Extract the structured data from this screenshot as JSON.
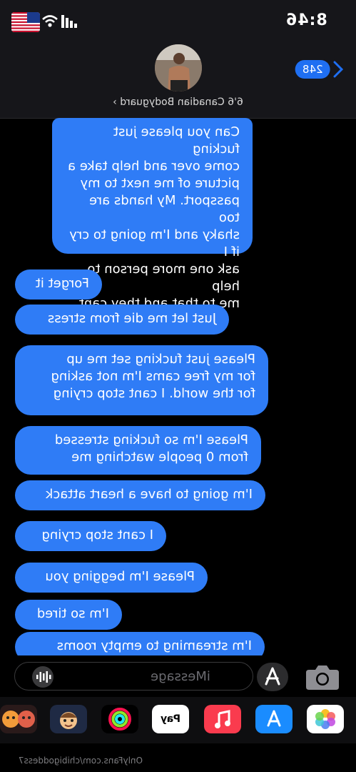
{
  "status": {
    "time": "8:46"
  },
  "header": {
    "back_count": "248",
    "contact_name": "6'6 Canadian Bodyguard"
  },
  "messages": [
    {
      "text": "Can you please just fucking\ncome over and help take a\npicture of me next to my\npassport. My hands are too\nshaky and I'm going to cry if I\nask one more person to help\nme to that and they cant."
    },
    {
      "text": "Forget it"
    },
    {
      "text": "Just let me die from stress"
    },
    {
      "text": "Please just fucking set me up\nfor my free cams I'm not asking\nfor the world. I cant stop crying"
    },
    {
      "text": "Please I'm so fucking stressed\nfrom 0 people watching me"
    },
    {
      "text": "I'm going to have a heart attack"
    },
    {
      "text": "I cant stop crying"
    },
    {
      "text": "Please I'm begging you"
    },
    {
      "text": "I'm so tired"
    },
    {
      "text": "I'm streaming to empty rooms"
    }
  ],
  "composer": {
    "placeholder": "iMessage"
  },
  "apps": [
    {
      "name": "photos",
      "color": "#ffffff"
    },
    {
      "name": "app-store",
      "color": "#1a8cff"
    },
    {
      "name": "music",
      "color": "#fa3b4e"
    },
    {
      "name": "apple-pay",
      "label": "Pay",
      "color": "#ffffff"
    },
    {
      "name": "activity",
      "color": "#000000"
    },
    {
      "name": "memoji",
      "color": "#f2b45c"
    },
    {
      "name": "stickers",
      "color": "#f29b3a"
    }
  ],
  "footer": {
    "url": "OnlyFans.com/chibigoddess7"
  }
}
